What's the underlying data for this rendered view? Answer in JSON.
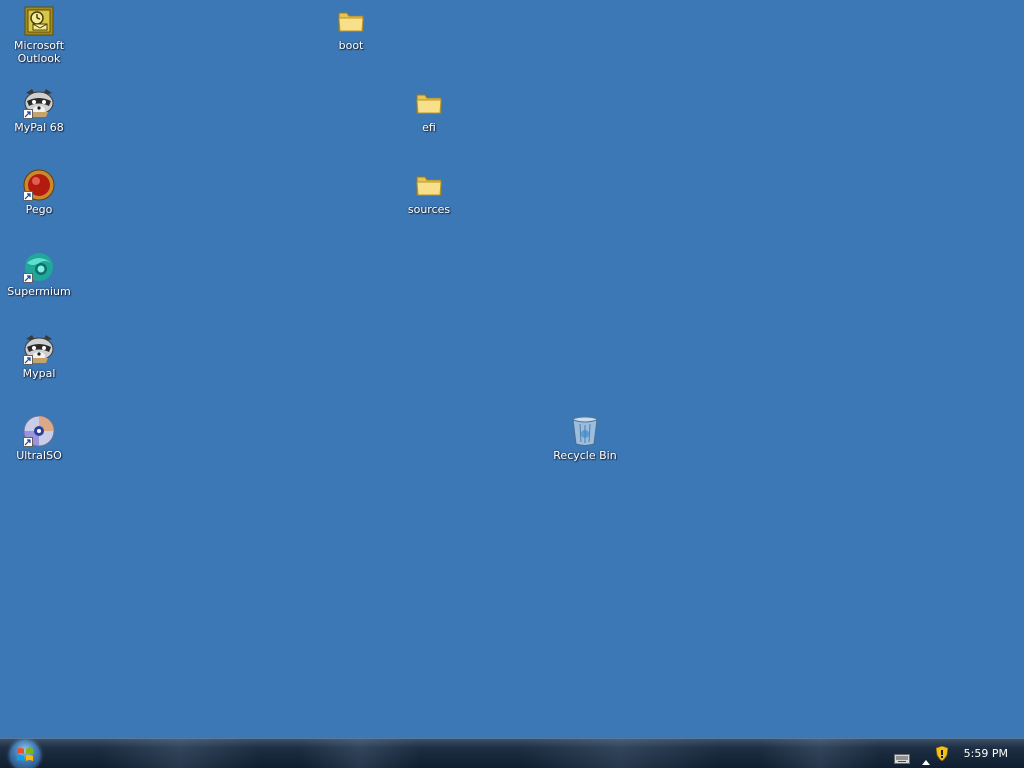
{
  "desktop": {
    "icons": {
      "outlook": {
        "label": "Microsoft\nOutlook"
      },
      "mypal68": {
        "label": "MyPal 68"
      },
      "pego": {
        "label": "Pego"
      },
      "supermium": {
        "label": "Supermium"
      },
      "mypal": {
        "label": "Mypal"
      },
      "ultraiso": {
        "label": "UltraISO"
      },
      "boot": {
        "label": "boot"
      },
      "efi": {
        "label": "efi"
      },
      "sources": {
        "label": "sources"
      },
      "recycle_bin": {
        "label": "Recycle Bin"
      }
    },
    "background_color": "#3c78b6"
  },
  "taskbar": {
    "clock": "5:59 PM",
    "tray_icons": [
      "keyboard-icon",
      "show-hidden-icons-arrow",
      "security-shield-icon"
    ]
  }
}
